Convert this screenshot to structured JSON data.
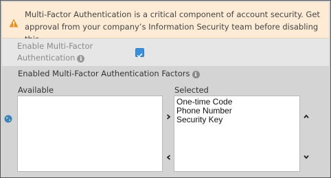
{
  "warning": {
    "icon": "warning-icon",
    "text": "Multi-Factor Authentication is a critical component of account security. Get approval from your company’s Information Security team before disabling this.",
    "background": "#fdebd6",
    "icon_color": "#e8911e"
  },
  "enable": {
    "label": "Enable Multi-Factor Authentication",
    "info_icon": "info-icon",
    "checked": true,
    "checkbox_color": "#3b8fd9"
  },
  "factors": {
    "title": "Enabled Multi-Factor Authentication Factors",
    "info_icon": "info-icon",
    "available_label": "Available",
    "selected_label": "Selected",
    "available_items": [],
    "selected_items": [
      "One-time Code",
      "Phone Number",
      "Security Key"
    ],
    "move_right_icon": "chevron-right-icon",
    "move_left_icon": "chevron-left-icon",
    "move_up_icon": "chevron-up-icon",
    "move_down_icon": "chevron-down-icon",
    "side_icon": "globe-icon"
  }
}
